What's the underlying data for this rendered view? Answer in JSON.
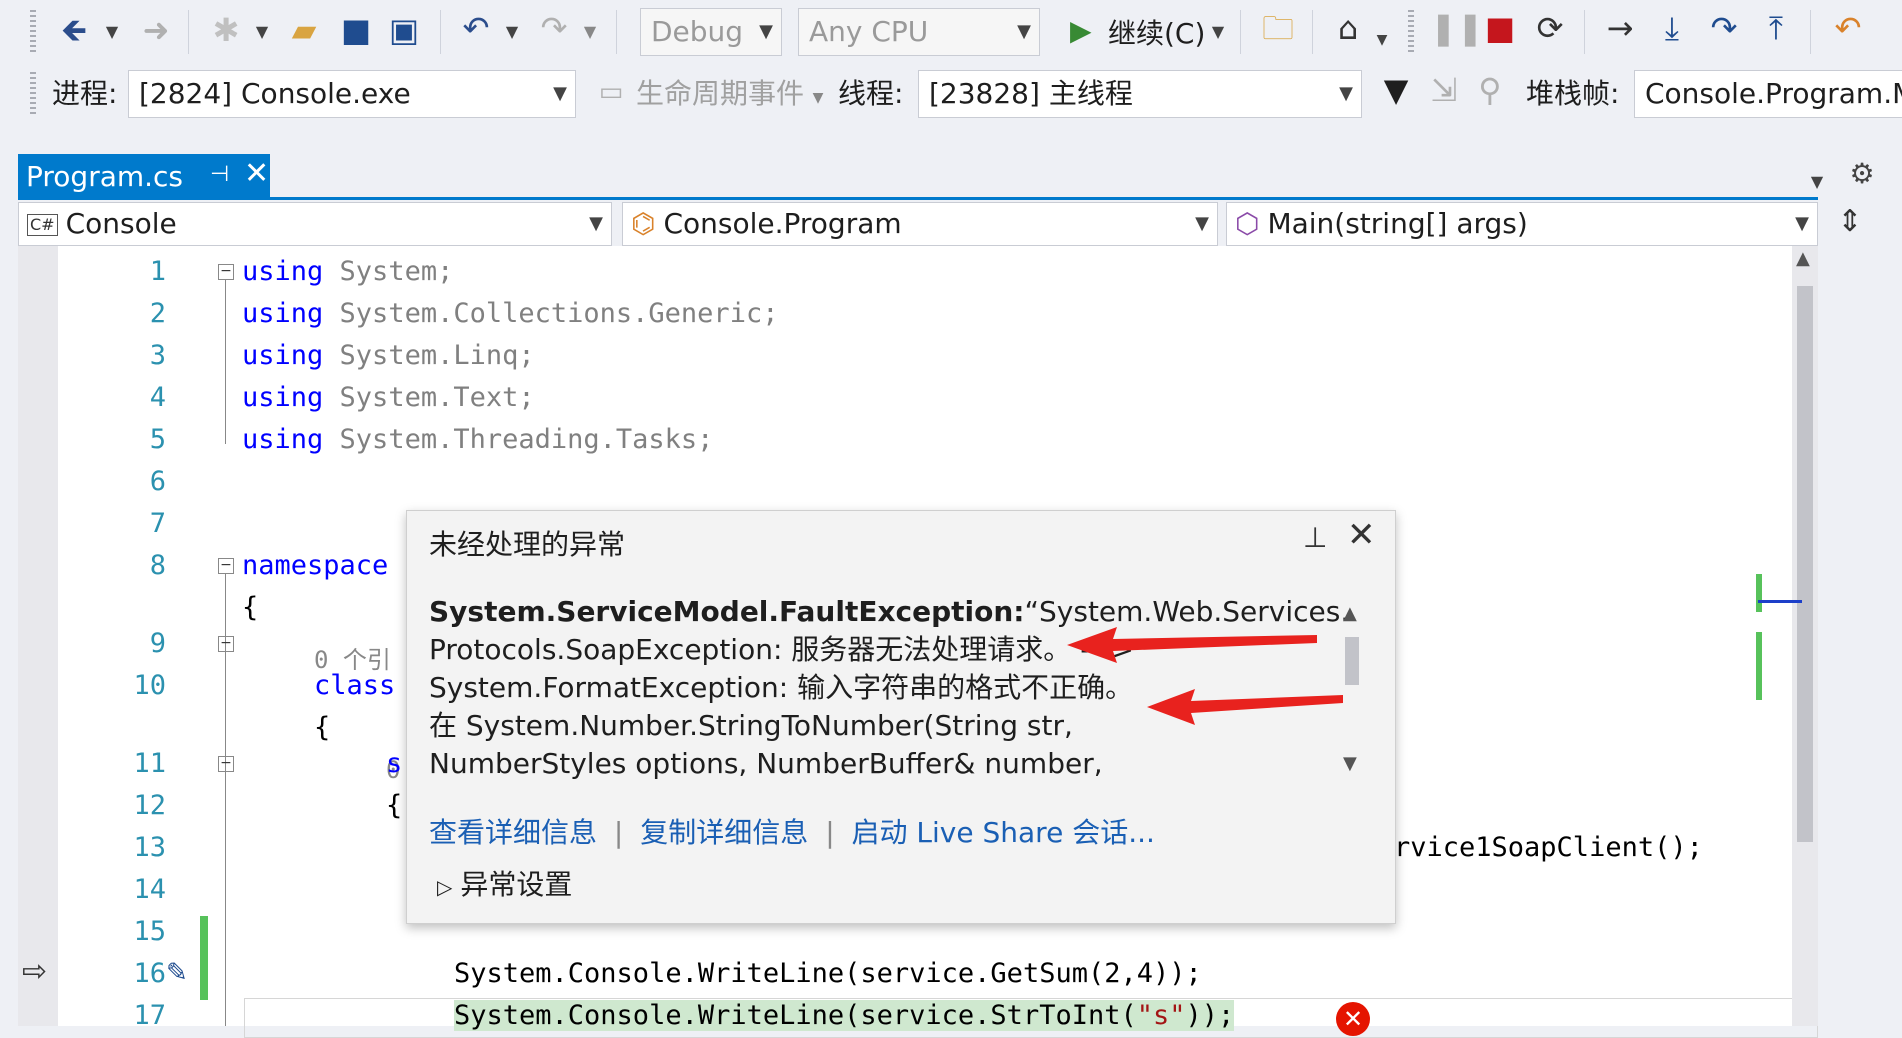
{
  "toolbar1": {
    "config": "Debug",
    "platform": "Any CPU",
    "continue_label": "继续(C)"
  },
  "toolbar2": {
    "process_label": "进程:",
    "process_value": "[2824] Console.exe",
    "lifecycle_label": "生命周期事件",
    "thread_label": "线程:",
    "thread_value": "[23828] 主线程",
    "stackframe_label": "堆栈帧:",
    "stackframe_value": "Console.Program.Ma"
  },
  "tab": {
    "title": "Program.cs"
  },
  "navbar": {
    "project": "Console",
    "type": "Console.Program",
    "member": "Main(string[] args)"
  },
  "code": {
    "line_numbers": [
      "1",
      "2",
      "3",
      "4",
      "5",
      "6",
      "7",
      "8",
      "9",
      "10",
      "11",
      "12",
      "13",
      "14",
      "15",
      "16",
      "17"
    ],
    "lines": {
      "l1": "System",
      "l1b": ";",
      "l2": "System",
      "l2b": ".Collections.Generic;",
      "l3": "System",
      "l3b": ".Linq;",
      "l4": "System",
      "l4b": ".Text;",
      "l5": "System",
      "l5b": ".Threading.Tasks;",
      "kw_using": "using",
      "kw_namespace": "namespace",
      "brace_open": "{",
      "ref_hint": "0 个引",
      "kw_class": "class",
      "ref_hint2": "0",
      "s_char": "s",
      "l13_tail": "rvice1SoapClient();",
      "l15": "System.Console.WriteLine(service.GetSum(2,4));",
      "l16_a": "System.Console.WriteLine(service.StrToInt(",
      "l16_str": "\"s\"",
      "l16_b": "));"
    }
  },
  "exception_popup": {
    "title": "未经处理的异常",
    "exception_type": "System.ServiceModel.FaultException:",
    "line1_rest": "“System.Web.Services.",
    "line2": "Protocols.SoapException: 服务器无法处理请求。 --->",
    "line3": "System.FormatException: 输入字符串的格式不正确。",
    "line4": "  在 System.Number.StringToNumber(String str,",
    "line5": "NumberStyles options, NumberBuffer& number,",
    "link_details": "查看详细信息",
    "link_copy": "复制详细信息",
    "link_liveshare": "启动 Live Share 会话...",
    "settings": "异常设置"
  },
  "colors": {
    "accent_blue": "#007acc",
    "arrow_red": "#e8221e",
    "error_red": "#e51400",
    "change_green": "#57c25b"
  }
}
